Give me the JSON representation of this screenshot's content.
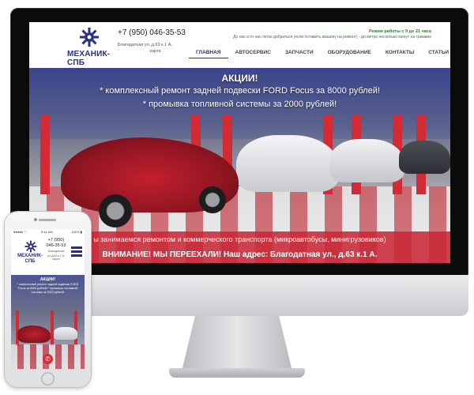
{
  "site": {
    "logo_text": "МЕХАНИК-СПБ",
    "phone": "+7 (950) 046-35-53",
    "address": "Благодатная ул.,д.63 к.1 А,",
    "map_link": "карта",
    "hours": "Режим работы с 9 до 21 часа",
    "hours_note": "До нас и от нас легко добраться (если оставить машину на ремонт) - до метро несколько минут на трамвае",
    "nav": [
      {
        "label": "ГЛАВНАЯ",
        "active": true
      },
      {
        "label": "АВТОСЕРВИС",
        "active": false
      },
      {
        "label": "ЗАПЧАСТИ",
        "active": false
      },
      {
        "label": "ОБОРУДОВАНИЕ",
        "active": false
      },
      {
        "label": "КОНТАКТЫ",
        "active": false
      },
      {
        "label": "СТАТЬИ",
        "active": false
      }
    ],
    "promo": {
      "title": "АКЦИИ!",
      "line1": "* комплексный ремонт задней подвески FORD Focus за 8000 рублей!",
      "line2": "* промывка топливной системы за 2000 рублей!"
    },
    "band1": "ы занимаемся ремонтом и коммерческого транспорта (микроавтобусы, минигрузовиков)",
    "band2": "ВНИМАНИЕ! МЫ ПЕРЕЕХАЛИ! Наш адрес: Благодатная ул., д.63 к.1 А."
  },
  "mobile": {
    "status": {
      "carrier": "●●●●● ⌔",
      "time": "9:41 AM",
      "battery": "100% ▮"
    },
    "logo_line1": "МЕХАНИК-",
    "logo_line2": "СПБ",
    "phone_line1": "+7 (950)",
    "phone_line2": "046-35-53",
    "address_line1": "Благодатная",
    "address_line2": "ул.,д.63 к.1 А,",
    "map_link": "карта",
    "promo_title": "АКЦИИ!",
    "promo_text": "* комплексный ремонт задней подвески FORD Focus за 8000 рублей! * промывка топливной системы за 2000 рублей!",
    "call_icon": "phone-icon"
  },
  "colors": {
    "brand": "#2a2f7a",
    "accent_red": "#d22b35",
    "hours_green": "#2e7d32"
  }
}
